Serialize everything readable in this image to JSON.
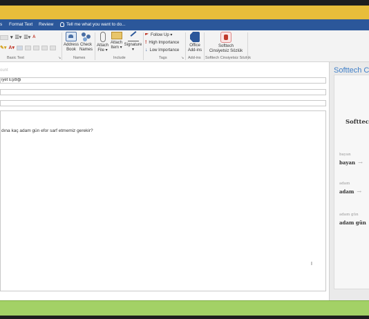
{
  "menu": {
    "tabs": [
      "s",
      "Format Text",
      "Review"
    ],
    "tell_me": "Tell me what you want to do..."
  },
  "ribbon": {
    "group_basic_text": "Basic Text",
    "names": {
      "address_book": [
        "Address",
        "Book"
      ],
      "check_names": [
        "Check",
        "Names"
      ],
      "label": "Names"
    },
    "include": {
      "attach_file": [
        "Attach",
        "File ▾"
      ],
      "attach_item": [
        "Attach",
        "Item ▾"
      ],
      "signature": [
        "Signature",
        "▾"
      ],
      "label": "Include"
    },
    "tags": {
      "follow_up": "Follow Up ▾",
      "high": "High Importance",
      "low": "Low Importance",
      "label": "Tags"
    },
    "addins": {
      "office": [
        "Office",
        "Add-ins"
      ],
      "label": "Add-ins"
    },
    "softtech": {
      "btn": [
        "Softtech",
        "Cinsiyetsiz Sözlük"
      ],
      "label": "Softtech Cinsiyetsiz Sözlük"
    }
  },
  "mail": {
    "hint": "ount",
    "subject": "iyet Eşitliği",
    "body": "dına kaç adam gün efor sarf etmemiz gerekir?"
  },
  "sidepane": {
    "title": "Softtech Cin",
    "brand": "Softtec",
    "suggestions": [
      {
        "word": "bayan",
        "label": "bayan"
      },
      {
        "word": "adam",
        "label": "adam"
      },
      {
        "word": "adam gün",
        "label": "adam gün"
      }
    ]
  },
  "icons": [
    "lightbulb-icon",
    "address-book-icon",
    "check-names-icon",
    "paperclip-icon",
    "envelope-icon",
    "signature-icon",
    "flag-icon",
    "high-importance-icon",
    "low-importance-icon",
    "office-addins-icon",
    "softtech-icon",
    "arrow-right-icon",
    "text-cursor-icon"
  ],
  "colors": {
    "accent": "#2b579a",
    "titlebar": "#e8bd3a",
    "statusbar": "#a3d166",
    "side_title": "#3f7fc8"
  }
}
